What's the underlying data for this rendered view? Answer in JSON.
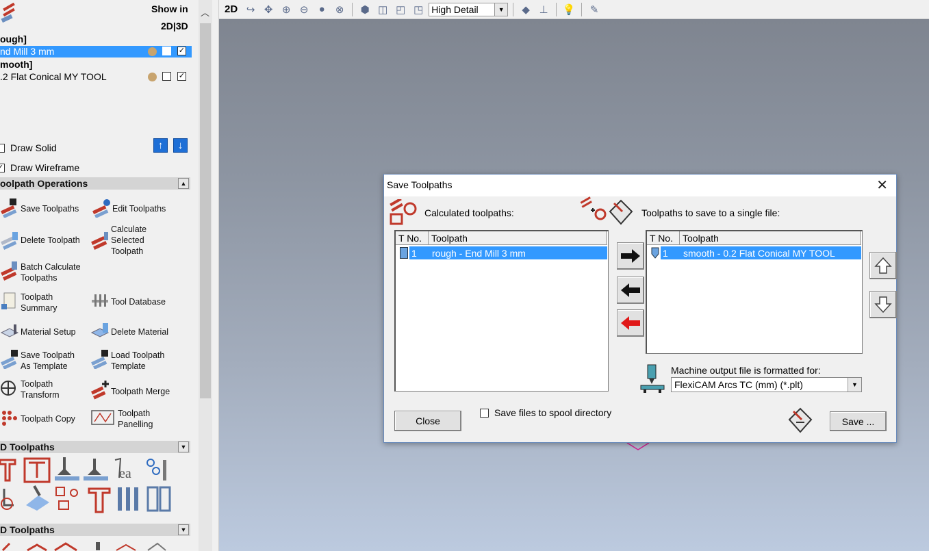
{
  "left_panel": {
    "show_in_label": "Show in",
    "show_in_modes": "2D|3D",
    "toolpaths": [
      {
        "group": "ough]",
        "tool": "nd Mill 3 mm",
        "selected": true,
        "visible_check": "✓"
      },
      {
        "group": "mooth]",
        "tool": ".2 Flat Conical MY TOOL",
        "selected": false,
        "visible_check": "✓"
      }
    ],
    "draw_solid_label": "Draw Solid",
    "draw_solid_checked": "",
    "draw_wireframe_label": "Draw Wireframe",
    "draw_wireframe_checked": "✓",
    "sections": {
      "toolpath_operations": "oolpath Operations",
      "toolpaths_2d": "D Toolpaths",
      "toolpaths_3d": "D Toolpaths"
    },
    "operations": [
      {
        "label": "Save Toolpaths"
      },
      {
        "label": "Edit Toolpaths"
      },
      {
        "label": "Delete Toolpath"
      },
      {
        "label": "Calculate Selected Toolpath"
      },
      {
        "label": "Batch Calculate Toolpaths"
      },
      {
        "label": "Toolpath Summary"
      },
      {
        "label": "Tool Database"
      },
      {
        "label": "Material Setup"
      },
      {
        "label": "Delete Material"
      },
      {
        "label": "Save Toolpath As Template"
      },
      {
        "label": "Load Toolpath Template"
      },
      {
        "label": "Toolpath Transform"
      },
      {
        "label": "Toolpath Merge"
      },
      {
        "label": "Toolpath Copy"
      },
      {
        "label": "Toolpath Panelling"
      }
    ]
  },
  "toolbar": {
    "mode_label": "2D",
    "detail_select": "High Detail"
  },
  "dialog": {
    "title": "Save Toolpaths",
    "calculated_label": "Calculated toolpaths:",
    "to_save_label": "Toolpaths to save to a single file:",
    "columns": {
      "tno": "T No.",
      "toolpath": "Toolpath"
    },
    "calculated_rows": [
      {
        "tno": "1",
        "name": "rough - End Mill 3 mm"
      }
    ],
    "save_rows": [
      {
        "tno": "1",
        "name": "smooth - 0.2 Flat Conical  MY TOOL"
      }
    ],
    "machine_label": "Machine output file is formatted for:",
    "machine_value": "FlexiCAM Arcs TC (mm) (*.plt)",
    "spool_label": "Save files to spool directory",
    "close_button": "Close",
    "save_button": "Save ...",
    "close_x": "✕"
  },
  "colors": {
    "selection": "#3399ff",
    "accent_red": "#c0392b",
    "blue_btn": "#1e6fd6"
  }
}
